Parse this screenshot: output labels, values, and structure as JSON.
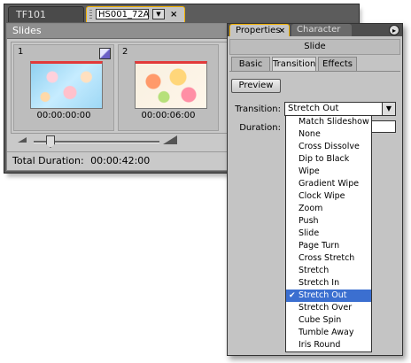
{
  "back_window": {
    "tabs": [
      {
        "label": "TF101"
      },
      {
        "label": "HS001_72A"
      }
    ],
    "close_glyph": "×",
    "dropdown_glyph": "▼",
    "panel_title": "Slides",
    "slides": [
      {
        "number": "1",
        "time": "00:00:00:00"
      },
      {
        "number": "2",
        "time": "00:00:06:00"
      }
    ],
    "total_duration_label": "Total Duration:",
    "total_duration_value": "00:00:42:00"
  },
  "properties_panel": {
    "tabs": [
      {
        "label": "Properties"
      },
      {
        "label": "Character"
      }
    ],
    "close_glyph": "×",
    "menu_glyph": "▸",
    "title": "Slide",
    "subtabs": [
      {
        "label": "Basic"
      },
      {
        "label": "Transition"
      },
      {
        "label": "Effects"
      }
    ],
    "active_subtab": "Transition",
    "preview_label": "Preview",
    "transition_label": "Transition:",
    "transition_value": "Stretch Out",
    "duration_label": "Duration:",
    "select_arrow": "▼",
    "check_glyph": "✔",
    "options": [
      "Match Slideshow",
      "None",
      "Cross Dissolve",
      "Dip to Black",
      "Wipe",
      "Gradient Wipe",
      "Clock Wipe",
      "Zoom",
      "Push",
      "Slide",
      "Page Turn",
      "Cross Stretch",
      "Stretch",
      "Stretch In",
      "Stretch Out",
      "Stretch Over",
      "Cube Spin",
      "Tumble Away",
      "Iris Round"
    ],
    "selected_index": 14
  },
  "colors": {
    "selection": "#3b6fd0",
    "active_tab_border": "#f0b000",
    "panel_bg": "#c4c4c4",
    "dark_bg": "#5c5c5c"
  }
}
